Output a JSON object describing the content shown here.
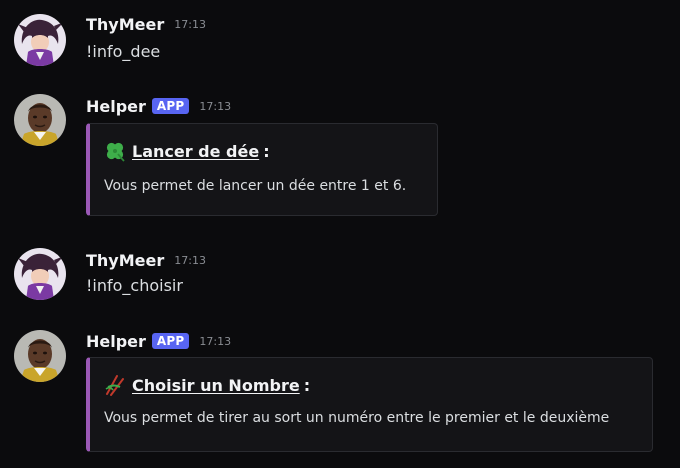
{
  "messages": [
    {
      "author": "ThyMeer",
      "time": "17:13",
      "text": "!info_dee",
      "avatar_icon": "user-avatar-icon"
    },
    {
      "author": "Helper",
      "badge": "APP",
      "time": "17:13",
      "avatar_icon": "bot-avatar-icon",
      "embed": {
        "emoji_icon": "four-leaf-clover-icon",
        "title": "Lancer de dée",
        "title_suffix": ":",
        "description": "Vous permet de lancer un dée entre 1 et 6."
      }
    },
    {
      "author": "ThyMeer",
      "time": "17:13",
      "text": "!info_choisir",
      "avatar_icon": "user-avatar-icon"
    },
    {
      "author": "Helper",
      "badge": "APP",
      "time": "17:13",
      "avatar_icon": "bot-avatar-icon",
      "embed": {
        "emoji_icon": "chopsticks-icon",
        "title": "Choisir un Nombre",
        "title_suffix": ":",
        "description": "Vous permet de tirer au sort un numéro entre le premier et le deuxième"
      }
    }
  ],
  "colors": {
    "background": "#0b0b0d",
    "embed_accent": "#9b59b6",
    "app_badge": "#5865f2",
    "username": "#f2f3f5",
    "timestamp": "#8a8d93"
  }
}
